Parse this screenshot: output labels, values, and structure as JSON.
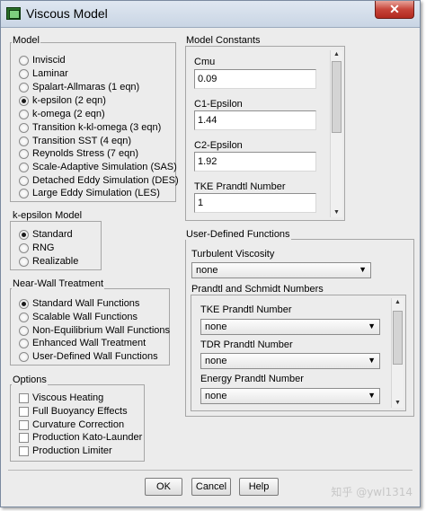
{
  "window": {
    "title": "Viscous Model",
    "close_glyph": "✕"
  },
  "model": {
    "label": "Model",
    "options": [
      {
        "label": "Inviscid",
        "selected": false
      },
      {
        "label": "Laminar",
        "selected": false
      },
      {
        "label": "Spalart-Allmaras (1 eqn)",
        "selected": false
      },
      {
        "label": "k-epsilon (2 eqn)",
        "selected": true
      },
      {
        "label": "k-omega (2 eqn)",
        "selected": false
      },
      {
        "label": "Transition k-kl-omega (3 eqn)",
        "selected": false
      },
      {
        "label": "Transition SST (4 eqn)",
        "selected": false
      },
      {
        "label": "Reynolds Stress (7 eqn)",
        "selected": false
      },
      {
        "label": "Scale-Adaptive Simulation (SAS)",
        "selected": false
      },
      {
        "label": "Detached Eddy Simulation (DES)",
        "selected": false
      },
      {
        "label": "Large Eddy Simulation (LES)",
        "selected": false
      }
    ]
  },
  "ke_model": {
    "label": "k-epsilon Model",
    "options": [
      {
        "label": "Standard",
        "selected": true
      },
      {
        "label": "RNG",
        "selected": false
      },
      {
        "label": "Realizable",
        "selected": false
      }
    ]
  },
  "near_wall": {
    "label": "Near-Wall Treatment",
    "options": [
      {
        "label": "Standard Wall Functions",
        "selected": true
      },
      {
        "label": "Scalable Wall Functions",
        "selected": false
      },
      {
        "label": "Non-Equilibrium Wall Functions",
        "selected": false
      },
      {
        "label": "Enhanced Wall Treatment",
        "selected": false
      },
      {
        "label": "User-Defined Wall Functions",
        "selected": false
      }
    ]
  },
  "options": {
    "label": "Options",
    "items": [
      {
        "label": "Viscous Heating",
        "checked": false
      },
      {
        "label": "Full Buoyancy Effects",
        "checked": false
      },
      {
        "label": "Curvature Correction",
        "checked": false
      },
      {
        "label": "Production Kato-Launder",
        "checked": false
      },
      {
        "label": "Production Limiter",
        "checked": false
      }
    ]
  },
  "constants": {
    "label": "Model Constants",
    "fields": [
      {
        "label": "Cmu",
        "value": "0.09"
      },
      {
        "label": "C1-Epsilon",
        "value": "1.44"
      },
      {
        "label": "C2-Epsilon",
        "value": "1.92"
      },
      {
        "label": "TKE Prandtl Number",
        "value": "1"
      }
    ]
  },
  "udf": {
    "label": "User-Defined Functions",
    "turbulent_viscosity": {
      "label": "Turbulent Viscosity",
      "value": "none"
    },
    "prandtl_label": "Prandtl and Schmidt Numbers",
    "prandtl_fields": [
      {
        "label": "TKE Prandtl Number",
        "value": "none"
      },
      {
        "label": "TDR Prandtl Number",
        "value": "none"
      },
      {
        "label": "Energy Prandtl Number",
        "value": "none"
      }
    ]
  },
  "buttons": {
    "ok": "OK",
    "cancel": "Cancel",
    "help": "Help"
  },
  "watermark": "知乎 @ywl1314",
  "scroll_arrows": {
    "up": "▲",
    "down": "▼"
  },
  "dropdown_caret": "▼"
}
